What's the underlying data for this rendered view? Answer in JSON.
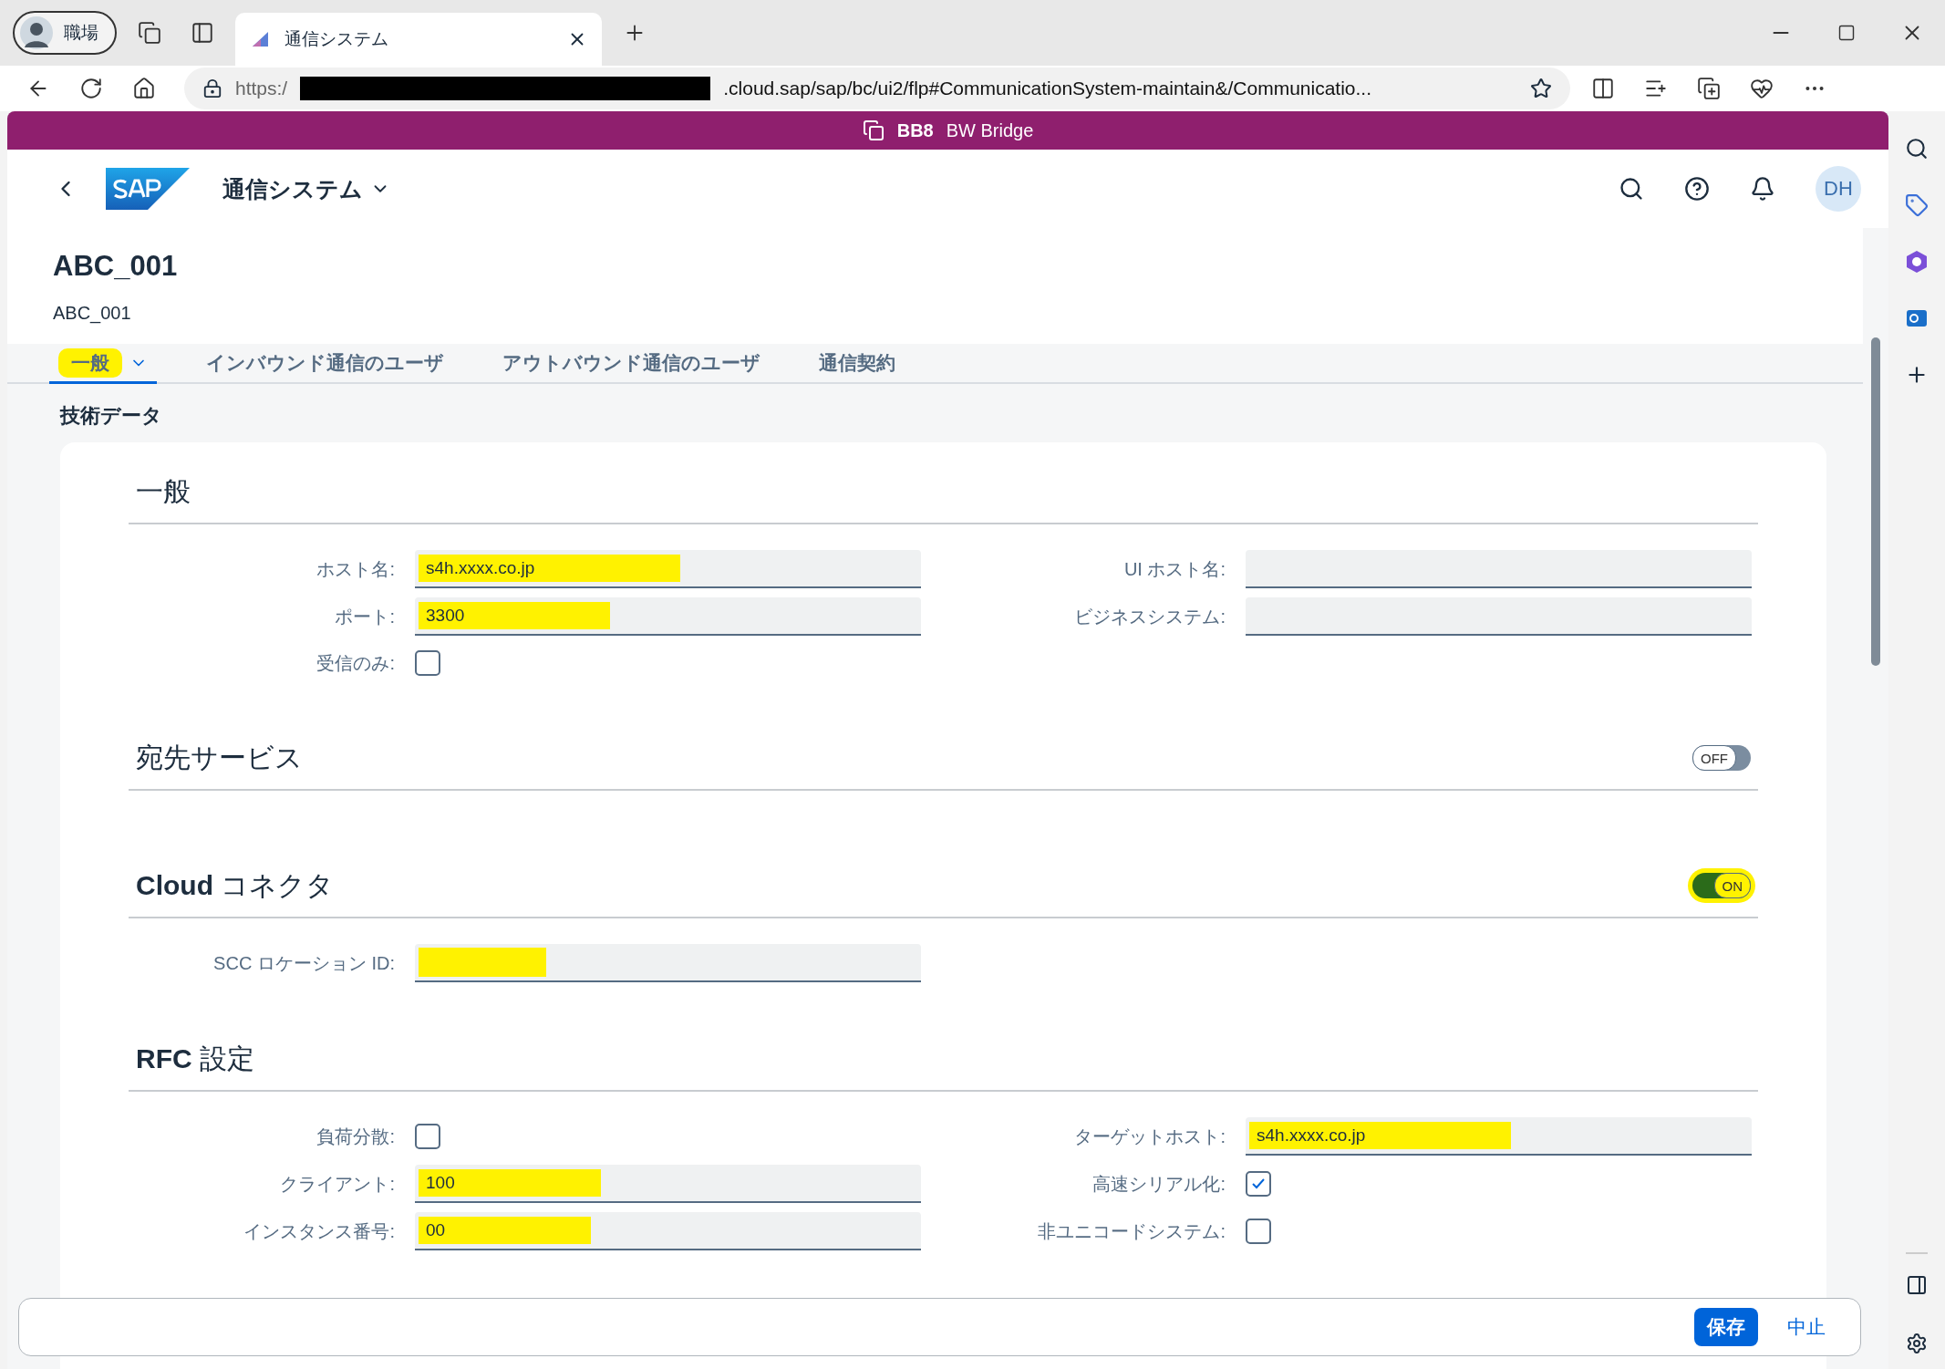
{
  "browser": {
    "profile": "職場",
    "tab_title": "通信システム",
    "url_start": "https:/",
    "url_end": ".cloud.sap/sap/bc/ui2/flp#CommunicationSystem-maintain&/Communicatio...",
    "url_redacted": true
  },
  "shell": {
    "system_id": "BB8",
    "system_name": "BW Bridge",
    "app_title": "通信システム",
    "avatar": "DH"
  },
  "header": {
    "title": "ABC_001",
    "subtitle": "ABC_001"
  },
  "tabs": [
    {
      "label": "一般",
      "selected": true,
      "has_menu": true,
      "highlighted": true
    },
    {
      "label": "インバウンド通信のユーザ",
      "selected": false,
      "has_menu": false,
      "highlighted": false
    },
    {
      "label": "アウトバウンド通信のユーザ",
      "selected": false,
      "has_menu": false,
      "highlighted": false
    },
    {
      "label": "通信契約",
      "selected": false,
      "has_menu": false,
      "highlighted": false
    }
  ],
  "section_title": "技術データ",
  "groups": [
    {
      "title": "一般",
      "left": [
        {
          "kind": "input",
          "label": "ホスト名:",
          "value": "s4h.xxxx.co.jp",
          "highlighted": true
        },
        {
          "kind": "input",
          "label": "ポート:",
          "value": "3300",
          "highlighted": true
        },
        {
          "kind": "checkbox",
          "label": "受信のみ:",
          "checked": false
        }
      ],
      "right": [
        {
          "kind": "input",
          "label": "UI ホスト名:",
          "highlighted": false
        },
        {
          "kind": "input",
          "label": "ビジネスシステム:",
          "highlighted": false
        }
      ]
    },
    {
      "title": "宛先サービス",
      "toggle": {
        "label": "OFF",
        "on": false,
        "highlighted": false
      }
    },
    {
      "title": "**Cloud** コネクタ",
      "toggle": {
        "label": "ON",
        "on": true,
        "highlighted": true
      },
      "left": [
        {
          "kind": "input",
          "label": "SCC ロケーション ID:",
          "highlighted": true
        }
      ]
    },
    {
      "title": "**RFC** 設定",
      "left": [
        {
          "kind": "checkbox",
          "label": "負荷分散:",
          "checked": false
        },
        {
          "kind": "input",
          "label": "クライアント:",
          "value": "100",
          "highlighted": true
        },
        {
          "kind": "input",
          "label": "インスタンス番号:",
          "value": "00",
          "highlighted": true
        }
      ],
      "right": [
        {
          "kind": "input",
          "label": "ターゲットホスト:",
          "value": "s4h.xxxx.co.jp",
          "highlighted": true
        },
        {
          "kind": "checkbox",
          "label": "高速シリアル化:",
          "checked": true
        },
        {
          "kind": "checkbox",
          "label": "非ユニコードシステム:",
          "checked": false
        }
      ]
    }
  ],
  "footer": {
    "buttons": [
      {
        "label": "保存",
        "kind": "emphasized"
      },
      {
        "label": "中止",
        "kind": "transparent"
      }
    ]
  }
}
